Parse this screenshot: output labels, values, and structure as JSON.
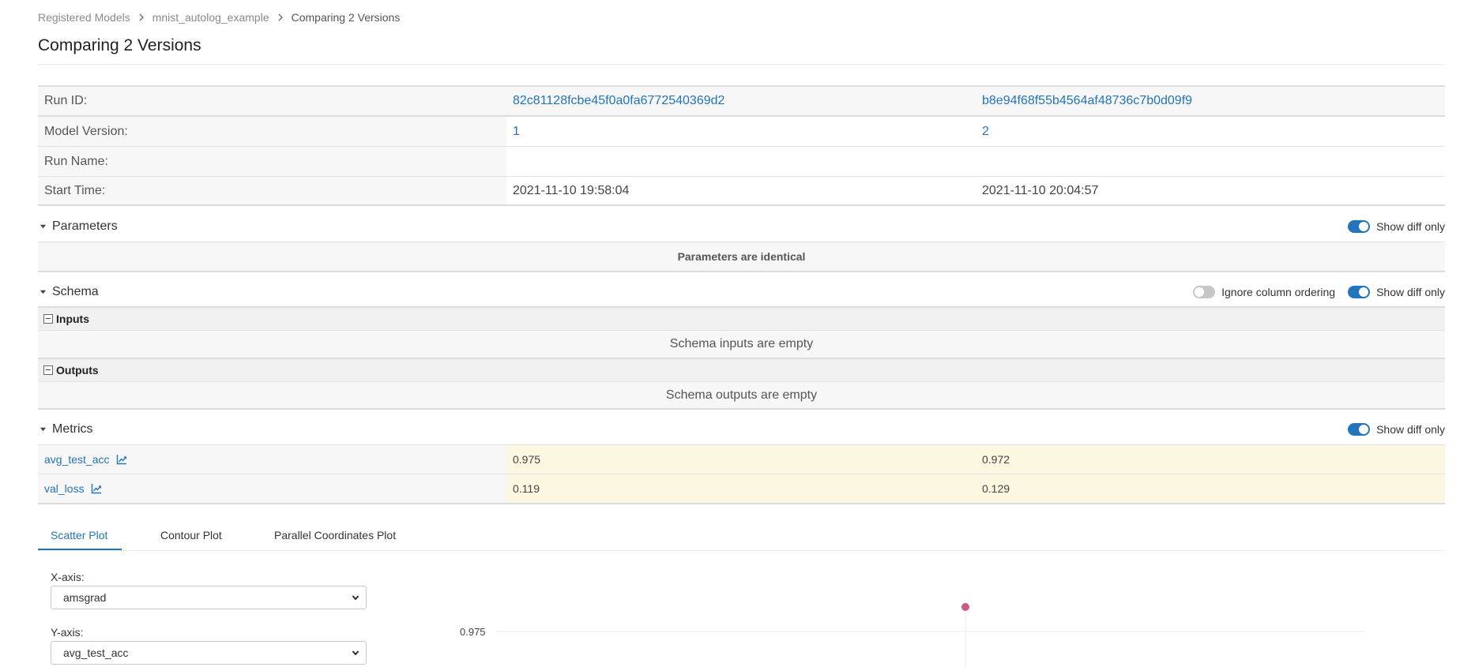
{
  "breadcrumb": {
    "items": [
      "Registered Models",
      "mnist_autolog_example",
      "Comparing 2 Versions"
    ]
  },
  "page_title": "Comparing 2 Versions",
  "info": {
    "run_id_label": "Run ID:",
    "run_id_1": "82c81128fcbe45f0a0fa6772540369d2",
    "run_id_2": "b8e94f68f55b4564af48736c7b0d09f9",
    "model_version_label": "Model Version:",
    "model_version_1": "1",
    "model_version_2": "2",
    "run_name_label": "Run Name:",
    "start_time_label": "Start Time:",
    "start_time_1": "2021-11-10 19:58:04",
    "start_time_2": "2021-11-10 20:04:57"
  },
  "parameters": {
    "title": "Parameters",
    "show_diff_label": "Show diff only",
    "show_diff_on": true,
    "message": "Parameters are identical"
  },
  "schema": {
    "title": "Schema",
    "ignore_column_label": "Ignore column ordering",
    "ignore_column_on": false,
    "show_diff_label": "Show diff only",
    "show_diff_on": true,
    "inputs_label": "Inputs",
    "inputs_message": "Schema inputs are empty",
    "outputs_label": "Outputs",
    "outputs_message": "Schema outputs are empty"
  },
  "metrics": {
    "title": "Metrics",
    "show_diff_label": "Show diff only",
    "show_diff_on": true,
    "rows": [
      {
        "name": "avg_test_acc",
        "v1": "0.975",
        "v2": "0.972"
      },
      {
        "name": "val_loss",
        "v1": "0.119",
        "v2": "0.129"
      }
    ]
  },
  "tabs": {
    "items": [
      "Scatter Plot",
      "Contour Plot",
      "Parallel Coordinates Plot"
    ],
    "active_index": 0
  },
  "axes": {
    "x_label": "X-axis:",
    "x_value": "amsgrad",
    "y_label": "Y-axis:",
    "y_value": "avg_test_acc"
  },
  "chart_data": {
    "type": "scatter",
    "y_tick_labels": [
      "0.975"
    ],
    "points": [
      {
        "y": 0.975
      }
    ],
    "marker_color": "#c75a8a"
  },
  "colors": {
    "accent": "#2374bb",
    "diff_highlight": "#fcf7e1"
  }
}
